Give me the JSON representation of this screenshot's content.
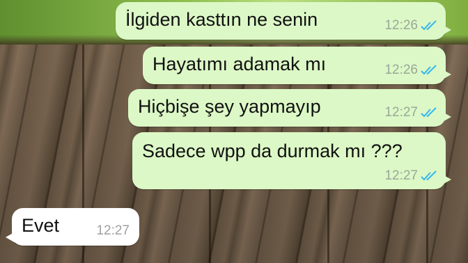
{
  "messages": [
    {
      "text": "İlgiden kasttın ne senin",
      "time": "12:26",
      "direction": "outgoing",
      "status": "read"
    },
    {
      "text": "Hayatımı adamak mı",
      "time": "12:26",
      "direction": "outgoing",
      "status": "read"
    },
    {
      "text": "Hiçbişe şey yapmayıp",
      "time": "12:27",
      "direction": "outgoing",
      "status": "read"
    },
    {
      "text": "Sadece wpp da durmak mı ???",
      "time": "12:27",
      "direction": "outgoing",
      "status": "read"
    },
    {
      "text": "Evet",
      "time": "12:27",
      "direction": "incoming"
    }
  ],
  "colors": {
    "outgoing_bubble": "#dcf8c6",
    "incoming_bubble": "#ffffff",
    "read_ticks": "#34b7f1"
  },
  "icons": {
    "read_status": "double-check-icon"
  }
}
